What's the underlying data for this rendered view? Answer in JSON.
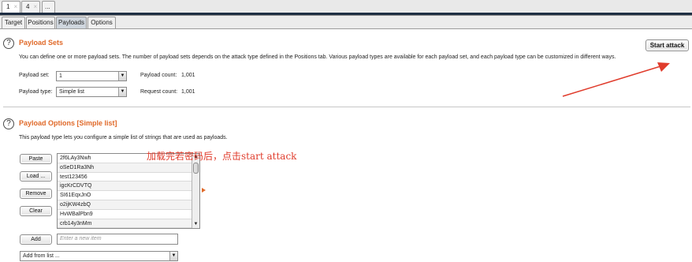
{
  "attack_tabs": [
    {
      "label": "1",
      "close": "×"
    },
    {
      "label": "4",
      "close": "×"
    },
    {
      "label": "..."
    }
  ],
  "subtabs": [
    "Target",
    "Positions",
    "Payloads",
    "Options"
  ],
  "payload_sets": {
    "help": "?",
    "title": "Payload Sets",
    "description": "You can define one or more payload sets. The number of payload sets depends on the attack type defined in the Positions tab. Various payload types are available for each payload set, and each payload type can be customized in different ways.",
    "payload_set_label": "Payload set:",
    "payload_set_value": "1",
    "payload_type_label": "Payload type:",
    "payload_type_value": "Simple list",
    "payload_count_label": "Payload count:",
    "payload_count_value": "1,001",
    "request_count_label": "Request count:",
    "request_count_value": "1,001",
    "start_attack": "Start attack"
  },
  "payload_options": {
    "help": "?",
    "title": "Payload Options [Simple list]",
    "description": "This payload type lets you configure a simple list of strings that are used as payloads.",
    "buttons": {
      "paste": "Paste",
      "load": "Load ...",
      "remove": "Remove",
      "clear": "Clear",
      "add": "Add"
    },
    "items": [
      "2f6LAy3Nwh",
      "oSeD1Ra3Nh",
      "test123456",
      "igcKrCDVTQ",
      "SI61EqxJnO",
      "o2ijKW4zbQ",
      "HvWBalPbn9",
      "crb14y3nMm"
    ],
    "new_item_placeholder": "Enter a new item",
    "add_from_list": "Add from list ..."
  },
  "annotation": "加载完若密码后，点击start attack",
  "colors": {
    "accent": "#e06a2a",
    "annotation": "#e03c2c",
    "dark_bar": "#1f2f44"
  },
  "icons": {
    "help": "help-circle-icon",
    "dropdown": "triangle-down-icon",
    "annotation_arrow": "arrow-icon"
  }
}
